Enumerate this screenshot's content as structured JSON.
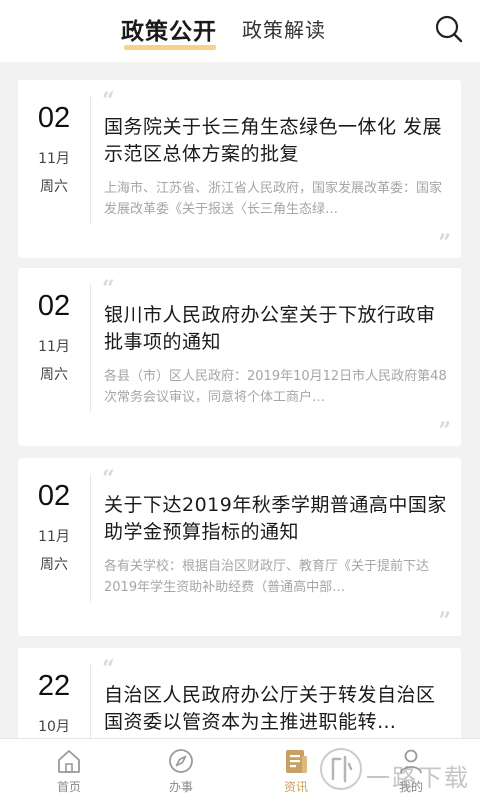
{
  "header": {
    "active_tab": "政策公开",
    "second_tab": "政策解读",
    "search_icon": "search-icon",
    "accent": "#f5d48a"
  },
  "articles": [
    {
      "day": "02",
      "month": "11月",
      "weekday": "周六",
      "title": "国务院关于长三角生态绿色一体化  发展示范区总体方案的批复",
      "summary": "上海市、江苏省、浙江省人民政府，国家发展改革委：国家发展改革委《关于报送〈长三角生态绿…"
    },
    {
      "day": "02",
      "month": "11月",
      "weekday": "周六",
      "title": "银川市人民政府办公室关于下放行政审批事项的通知",
      "summary": "各县（市）区人民政府：2019年10月12日市人民政府第48次常务会议审议，同意将个体工商户…"
    },
    {
      "day": "02",
      "month": "11月",
      "weekday": "周六",
      "title": "关于下达2019年秋季学期普通高中国家助学金预算指标的通知",
      "summary": "各有关学校：根据自治区财政厅、教育厅《关于提前下达2019年学生资助补助经费（普通高中部…"
    },
    {
      "day": "22",
      "month": "10月",
      "weekday": "",
      "title": "自治区人民政府办公厅关于转发自治区国资委以管资本为主推进职能转…",
      "summary": ""
    }
  ],
  "quote_open": "“",
  "quote_close": "”",
  "bottom_nav": [
    {
      "label": "首页",
      "icon": "home-icon",
      "active": false
    },
    {
      "label": "办事",
      "icon": "compass-icon",
      "active": false
    },
    {
      "label": "资讯",
      "icon": "news-icon",
      "active": true
    },
    {
      "label": "我的",
      "icon": "user-icon",
      "active": false
    }
  ],
  "active_color": "#c9a063",
  "watermark": {
    "text": "一路下载"
  }
}
